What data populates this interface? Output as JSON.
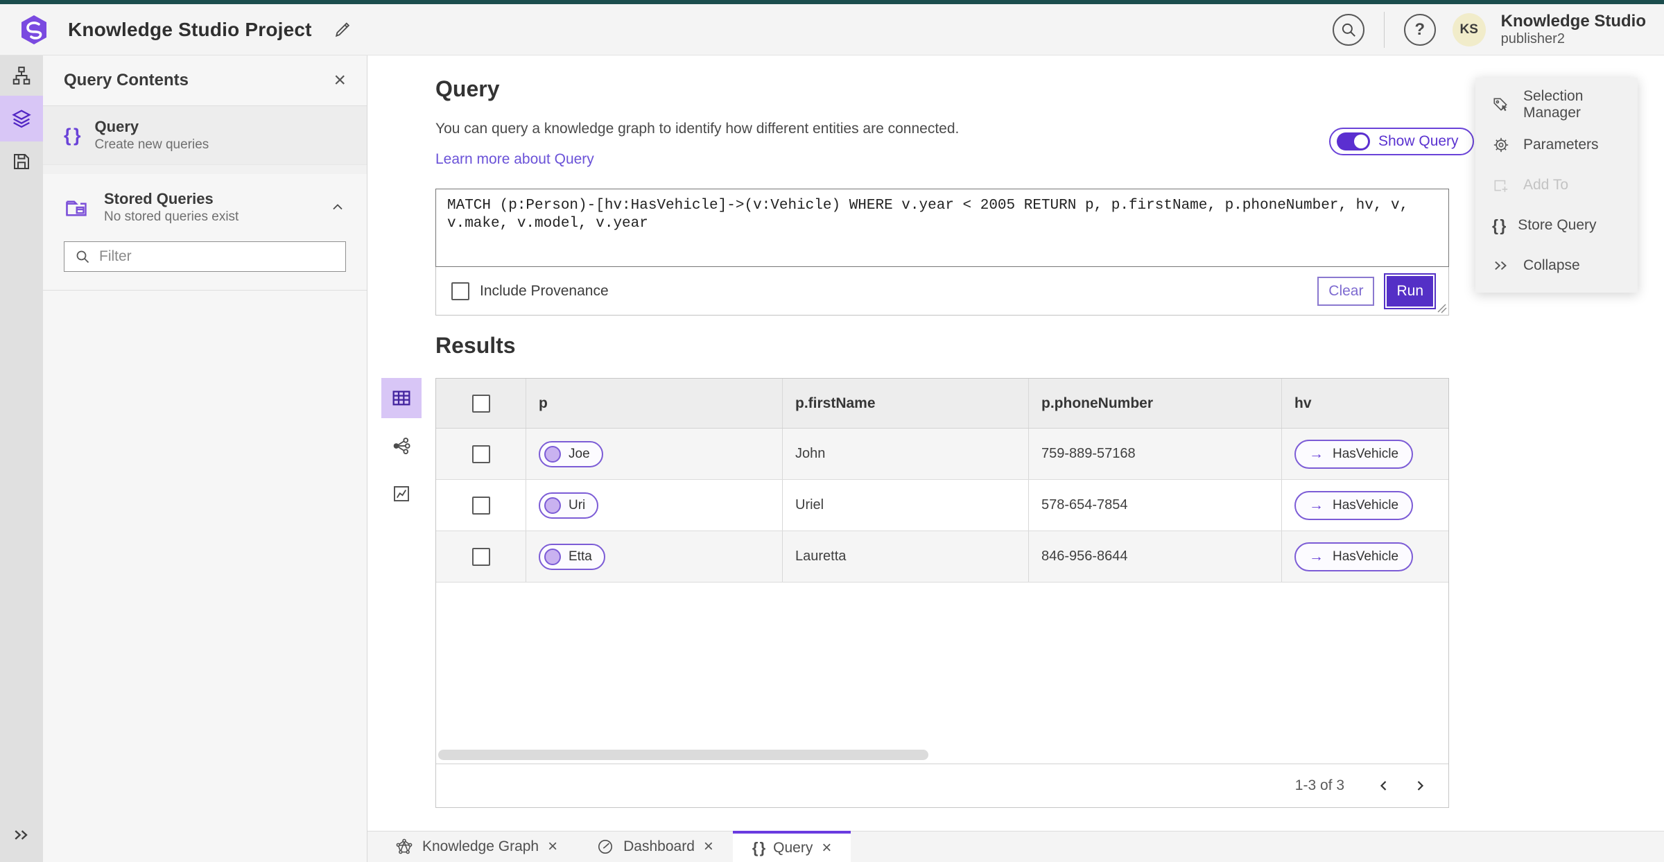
{
  "header": {
    "title": "Knowledge Studio Project",
    "user_initials": "KS",
    "user_name": "Knowledge Studio",
    "user_role": "publisher2"
  },
  "icons": {
    "help": "?",
    "close": "×",
    "braces": "{ }",
    "arrow_right": "→"
  },
  "sidebar": {
    "panel_title": "Query Contents",
    "query_item": {
      "title": "Query",
      "subtitle": "Create new queries"
    },
    "stored_queries": {
      "title": "Stored Queries",
      "subtitle": "No stored queries exist"
    },
    "filter_placeholder": "Filter"
  },
  "query_section": {
    "title": "Query",
    "description": "You can query a knowledge graph to identify how different entities are connected.",
    "learn_more_label": "Learn more about Query",
    "show_query_label": "Show Query",
    "query_text": "MATCH (p:Person)-[hv:HasVehicle]->(v:Vehicle) WHERE v.year < 2005 RETURN p, p.firstName, p.phoneNumber, hv, v, v.make, v.model, v.year",
    "include_provenance_label": "Include Provenance",
    "clear_label": "Clear",
    "run_label": "Run"
  },
  "results": {
    "title": "Results",
    "columns": [
      "p",
      "p.firstName",
      "p.phoneNumber",
      "hv"
    ],
    "rows": [
      {
        "p": "Joe",
        "firstName": "John",
        "phoneNumber": "759-889-57168",
        "hv": "HasVehicle"
      },
      {
        "p": "Uri",
        "firstName": "Uriel",
        "phoneNumber": "578-654-7854",
        "hv": "HasVehicle"
      },
      {
        "p": "Etta",
        "firstName": "Lauretta",
        "phoneNumber": "846-956-8644",
        "hv": "HasVehicle"
      }
    ],
    "pagination_label": "1-3 of 3"
  },
  "actions_panel": {
    "selection_manager": "Selection Manager",
    "parameters": "Parameters",
    "add_to": "Add To",
    "store_query": "Store Query",
    "collapse": "Collapse"
  },
  "tabs": {
    "knowledge_graph": "Knowledge Graph",
    "dashboard": "Dashboard",
    "query": "Query"
  },
  "colors": {
    "accent": "#6a43d8",
    "accent_dark": "#5430c6",
    "link": "#6a52d8",
    "pill_border": "#7c5cd6",
    "pill_circle": "#c9b2f0",
    "selected_tint": "#d8c6f6",
    "top_strip": "#1b4d4d",
    "header_bg": "#f4f4f4",
    "rail_bg": "#e0e0e0",
    "panel_bg": "#f6f6f6",
    "table_header_bg": "#ededed",
    "row_alt": "#f5f5f5",
    "avatar_bg": "#f1ecca"
  }
}
